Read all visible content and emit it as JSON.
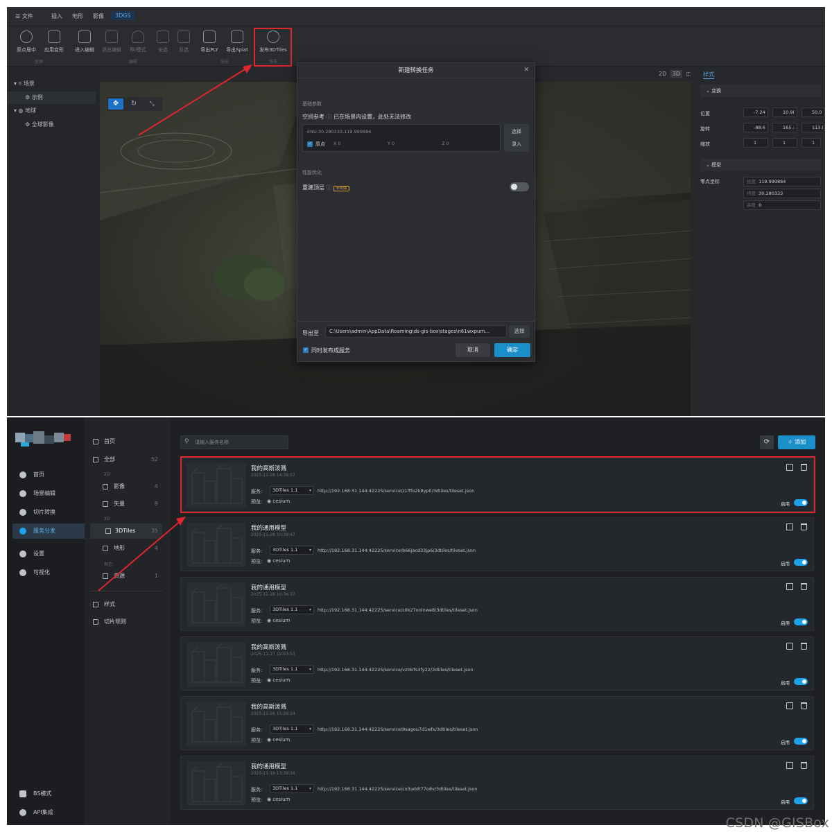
{
  "top": {
    "menubar": {
      "file": "文件",
      "items": [
        "插入",
        "地形",
        "影像",
        "3DGS"
      ]
    },
    "toolbar": {
      "tools": [
        "原点居中",
        "应用变形",
        "进入编辑",
        "退出编辑",
        "样/模式",
        "全选",
        "反选",
        "导出PLY",
        "导出Splat",
        "发布3DTiles"
      ],
      "groups": [
        "变换",
        "编辑",
        "导出",
        "发布"
      ]
    },
    "tree": {
      "scene": "场景",
      "example": "示例",
      "globe": "地球",
      "imagery": "全球影像"
    },
    "view_modes": [
      "2D",
      "3D"
    ],
    "right_panel": {
      "tab": "样式",
      "transform": "变换",
      "rows": [
        {
          "label": "位置",
          "x": "-7.24",
          "y": "10.9(",
          "z": "50.0"
        },
        {
          "label": "旋转",
          "x": "-88.6",
          "y": "165.:",
          "z": "113.("
        },
        {
          "label": "缩放",
          "x": "1",
          "y": "1",
          "z": "1"
        }
      ],
      "model": "模型",
      "ref_coord": "零点坐标",
      "lon_label": "经度",
      "lon": "119.999884",
      "lat_label": "纬度",
      "lat": "30.280333",
      "alt_label": "高度",
      "alt": "0"
    },
    "dialog": {
      "title": "新建转换任务",
      "basic": "基础参数",
      "spatial_ref": "空间参考",
      "spatial_note": "已在场景内设置，此处无法修改",
      "enu": "ENU:30.280333,119.999884",
      "origin": "原点",
      "x": "X 0",
      "y": "Y 0",
      "z": "Z 0",
      "select": "选择",
      "enter": "录入",
      "perf": "性能优化",
      "rebuild": "重建顶层",
      "pro": "专业版",
      "export_to": "导出至",
      "export_path": "C:\\Users\\admin\\AppData\\Roaming\\ds-gis-box\\stages\\n61wxpum…",
      "export_select": "选择",
      "publish": "同时发布成服务",
      "cancel": "取消",
      "ok": "确定"
    }
  },
  "bottom": {
    "nav": [
      "首页",
      "场景编辑",
      "切片转换",
      "服务分发",
      "设置",
      "可视化"
    ],
    "nav_bottom": [
      "BS模式",
      "API集成"
    ],
    "cats": {
      "home": "首页",
      "all": "全部",
      "all_n": "52",
      "h2d": "2D",
      "imagery": "影像",
      "imagery_n": "4",
      "vector": "矢量",
      "vector_n": "8",
      "h3d": "3D",
      "tiles": "3DTiles",
      "tiles_n": "35",
      "terrain": "地形",
      "terrain_n": "4",
      "other": "其它",
      "resource": "资源",
      "resource_n": "1",
      "style": "样式",
      "rules": "切片规则"
    },
    "search_placeholder": "请输入服务名称",
    "add": "添加",
    "service_label": "服务:",
    "preview_label": "预览:",
    "enable_label": "启用",
    "cards": [
      {
        "title": "我的高斯泼溅",
        "date": "2025-11-28 14:36:57",
        "type": "3DTiles 1.1",
        "url": "http://192.168.31.144:42225/service/z1fffo2k8yp0/3dtiles/tileset.json",
        "preview": "cesium"
      },
      {
        "title": "我的通用模型",
        "date": "2025-11-28 10:39:47",
        "type": "3DTiles 1.1",
        "url": "http://192.168.31.144:42225/service/b66jacd33jp6/3dtiles/tileset.json",
        "preview": "cesium"
      },
      {
        "title": "我的通用模型",
        "date": "2025-11-28 10:36:37",
        "type": "3DTiles 1.1",
        "url": "http://192.168.31.144:42225/service/z0k27onlnwe8/3dtiles/tileset.json",
        "preview": "cesium"
      },
      {
        "title": "我的高斯泼溅",
        "date": "2025-11-27 19:03:53",
        "type": "3DTiles 1.1",
        "url": "http://192.168.31.144:42225/service/vzt6rfs3fy22/3dtiles/tileset.json",
        "preview": "cesium"
      },
      {
        "title": "我的高斯泼溅",
        "date": "2025-11-26 15:26:24",
        "type": "3DTiles 1.1",
        "url": "http://192.168.31.144:42225/service/9sagou7d1wfx/3dtiles/tileset.json",
        "preview": "cesium"
      },
      {
        "title": "我的通用模型",
        "date": "2025-11-19 13:39:16",
        "type": "3DTiles 1.1",
        "url": "http://192.168.31.144:42225/service/co3addt77o8v/3dtiles/tileset.json",
        "preview": "cesium"
      }
    ]
  },
  "watermark": "CSDN @GISBox"
}
